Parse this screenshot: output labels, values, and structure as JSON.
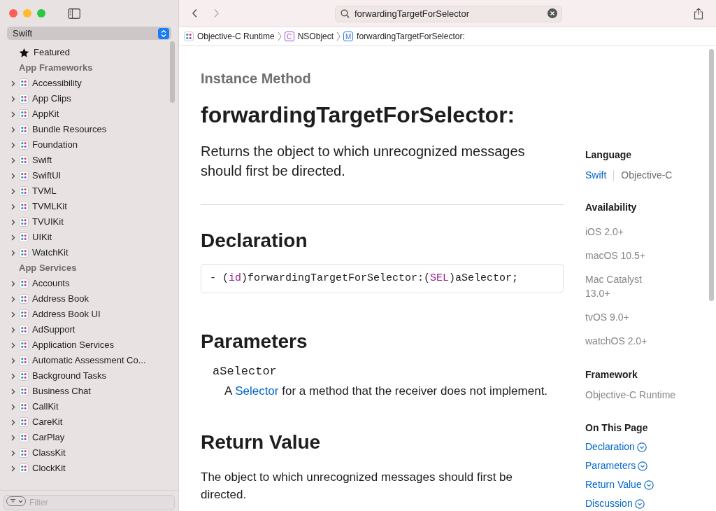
{
  "sidebar": {
    "language_picker": {
      "value": "Swift"
    },
    "featured": {
      "label": "Featured"
    },
    "sections": [
      {
        "title": "App Frameworks",
        "items": [
          {
            "label": "Accessibility",
            "expanded": false
          },
          {
            "label": "App Clips",
            "expanded": false
          },
          {
            "label": "AppKit",
            "expanded": false
          },
          {
            "label": "Bundle Resources",
            "expanded": false
          },
          {
            "label": "Foundation",
            "expanded": false
          },
          {
            "label": "Swift",
            "expanded": false
          },
          {
            "label": "SwiftUI",
            "expanded": false
          },
          {
            "label": "TVML",
            "expanded": false
          },
          {
            "label": "TVMLKit",
            "expanded": false
          },
          {
            "label": "TVUIKit",
            "expanded": false
          },
          {
            "label": "UIKit",
            "expanded": false
          },
          {
            "label": "WatchKit",
            "expanded": false
          }
        ]
      },
      {
        "title": "App Services",
        "items": [
          {
            "label": "Accounts",
            "expanded": false
          },
          {
            "label": "Address Book",
            "expanded": false
          },
          {
            "label": "Address Book UI",
            "expanded": false
          },
          {
            "label": "AdSupport",
            "expanded": false
          },
          {
            "label": "Application Services",
            "expanded": false
          },
          {
            "label": "Automatic Assessment Co...",
            "expanded": false
          },
          {
            "label": "Background Tasks",
            "expanded": false
          },
          {
            "label": "Business Chat",
            "expanded": false
          },
          {
            "label": "CallKit",
            "expanded": false
          },
          {
            "label": "CareKit",
            "expanded": false
          },
          {
            "label": "CarPlay",
            "expanded": false
          },
          {
            "label": "ClassKit",
            "expanded": false
          },
          {
            "label": "ClockKit",
            "expanded": false
          }
        ]
      }
    ],
    "filter": {
      "placeholder": "Filter"
    }
  },
  "toolbar": {
    "search": {
      "value": "forwardingTargetForSelector"
    }
  },
  "breadcrumbs": [
    {
      "kind": "framework",
      "label": "Objective-C Runtime"
    },
    {
      "kind": "class",
      "badge": "C",
      "label": "NSObject"
    },
    {
      "kind": "method",
      "badge": "M",
      "label": "forwardingTargetForSelector:"
    }
  ],
  "article": {
    "eyebrow": "Instance Method",
    "title": "forwardingTargetForSelector:",
    "abstract": "Returns the object to which unrecognized messages should first be directed.",
    "declaration": {
      "heading": "Declaration",
      "tokens": [
        {
          "kind": "plain",
          "text": "- ("
        },
        {
          "kind": "keyword",
          "text": "id"
        },
        {
          "kind": "plain",
          "text": ")forwardingTargetForSelector:("
        },
        {
          "kind": "keyword",
          "text": "SEL"
        },
        {
          "kind": "plain",
          "text": ")aSelector;"
        }
      ]
    },
    "parameters": {
      "heading": "Parameters",
      "items": [
        {
          "name": "aSelector",
          "description": [
            {
              "kind": "text",
              "text": "A "
            },
            {
              "kind": "link",
              "text": "Selector"
            },
            {
              "kind": "text",
              "text": " for a method that the receiver does not implement."
            }
          ]
        }
      ]
    },
    "return_value": {
      "heading": "Return Value",
      "text": "The object to which unrecognized messages should first be directed."
    }
  },
  "aside": {
    "language": {
      "heading": "Language",
      "options": [
        {
          "label": "Swift",
          "selected": false
        },
        {
          "label": "Objective-C",
          "selected": true
        }
      ]
    },
    "availability": {
      "heading": "Availability",
      "platforms": [
        "iOS 2.0+",
        "macOS 10.5+",
        "Mac Catalyst 13.0+",
        "tvOS 9.0+",
        "watchOS 2.0+"
      ]
    },
    "framework": {
      "heading": "Framework",
      "name": "Objective-C Runtime"
    },
    "on_this_page": {
      "heading": "On This Page",
      "links": [
        "Declaration",
        "Parameters",
        "Return Value",
        "Discussion"
      ]
    }
  }
}
